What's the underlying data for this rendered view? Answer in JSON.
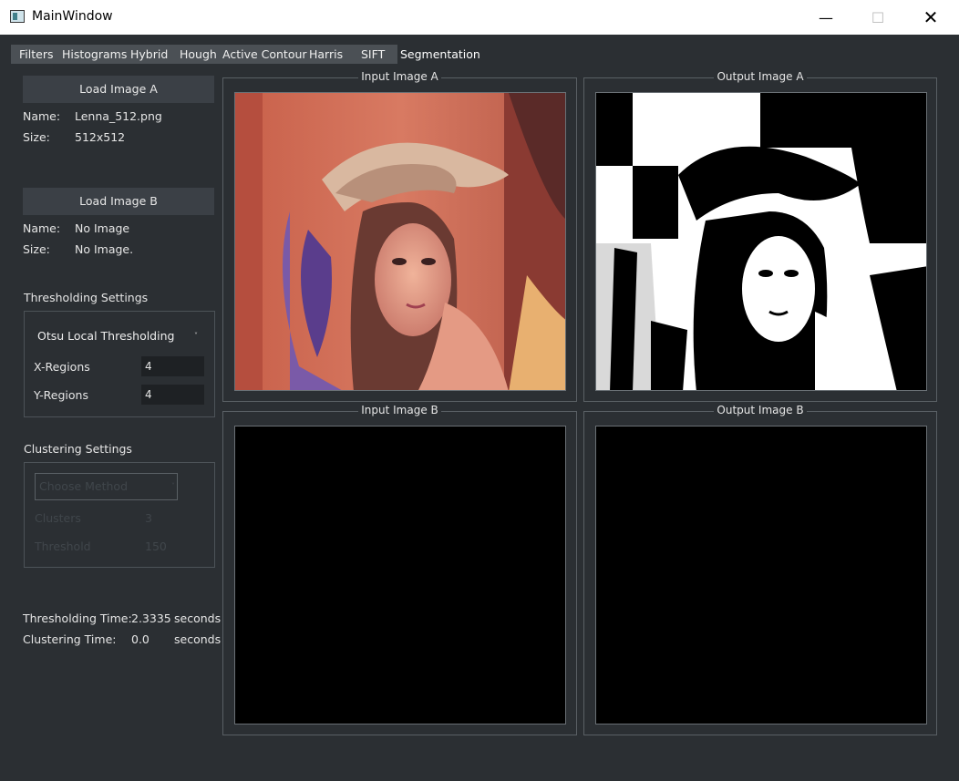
{
  "window": {
    "title": "MainWindow",
    "minimize": "—",
    "maximize": "☐",
    "close": "✕"
  },
  "tabs": [
    "Filters",
    "Histograms",
    "Hybrid",
    "Hough",
    "Active Contour",
    "Harris",
    "SIFT",
    "Segmentation"
  ],
  "image_a": {
    "button": "Load Image A",
    "name_label": "Name:",
    "name": "Lenna_512.png",
    "size_label": "Size:",
    "size": "512x512"
  },
  "image_b": {
    "button": "Load Image B",
    "name_label": "Name:",
    "name": "No Image",
    "size_label": "Size:",
    "size": "No Image."
  },
  "thresholding": {
    "title": "Thresholding Settings",
    "method": "Otsu Local Thresholding",
    "x_label": "X-Regions",
    "x_value": "4",
    "y_label": "Y-Regions",
    "y_value": "4"
  },
  "clustering": {
    "title": "Clustering Settings",
    "method_placeholder": "Choose Method",
    "clusters_label": "Clusters",
    "clusters_value": "3",
    "threshold_label": "Threshold",
    "threshold_value": "150"
  },
  "timing": {
    "thresholding_label": "Thresholding Time:",
    "thresholding_value": "2.3335",
    "thresholding_unit": "seconds",
    "clustering_label": "Clustering Time:",
    "clustering_value": "0.0",
    "clustering_unit": "seconds"
  },
  "panels": {
    "input_a": "Input Image A",
    "output_a": "Output Image A",
    "input_b": "Input Image B",
    "output_b": "Output Image B"
  },
  "colors": {
    "background": "#2b2f33",
    "button": "#3b4046",
    "field": "#1e2124",
    "tabbar": "#4b5055"
  }
}
